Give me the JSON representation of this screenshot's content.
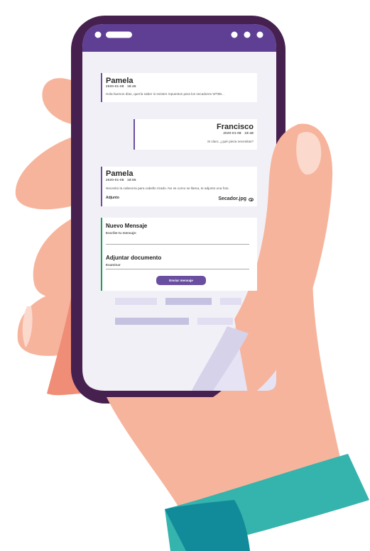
{
  "messages": [
    {
      "name": "Pamela",
      "date": "2020-01-08",
      "time": "18:45",
      "text": "Hola buenos días, quería saber si existen repuestos para los secadores WT88..."
    },
    {
      "name": "Francisco",
      "date": "2020-01-08",
      "time": "18:48",
      "text": "Si claro, ¿qué pieza necesitas?"
    },
    {
      "name": "Pamela",
      "date": "2020-01-08",
      "time": "18:55",
      "text": "Necesito la cabecera para cabello rizado. No se como se llama, te adjunto una foto.",
      "attachment_label": "Adjunto",
      "attachment_file": "Secador.jpg"
    }
  ],
  "form": {
    "title": "Nuevo Mensaje",
    "message_label": "Escribe tu mensaje:",
    "attach_title": "Adjuntar documento",
    "browse_label": "Examinar",
    "send_button": "Enviar mensaje"
  },
  "colors": {
    "phone_body": "#46204f",
    "header": "#5f3f94",
    "screen": "#f2f0f7",
    "skin": "#f7b49c",
    "skin_shadow": "#ef8d77",
    "cuff": "#35b3ad",
    "cuff_dark": "#118a9a",
    "accent": "#6a4fa0",
    "form_accent": "#1e9e4e"
  },
  "icons": [
    "dots-icon",
    "pill-icon",
    "eye-icon"
  ]
}
